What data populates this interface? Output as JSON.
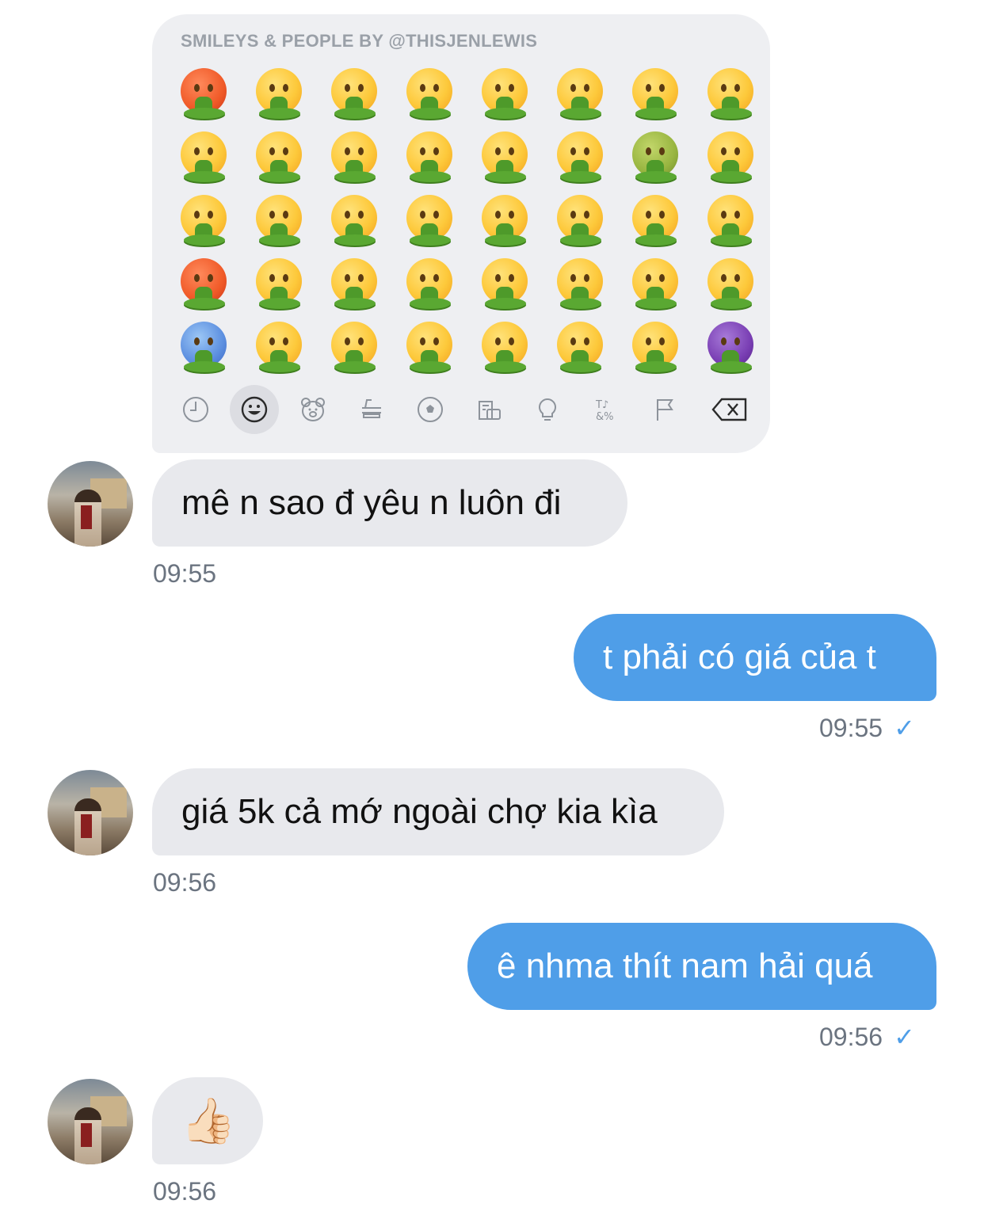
{
  "keyboard": {
    "title": "SMILEYS & PEOPLE BY @THISJENLEWIS",
    "emoji_rows": [
      [
        "angry-face-with-symbols-vomiting",
        "screaming-face-vomiting",
        "face-with-open-hands-vomiting",
        "neutral-face-vomiting",
        "hushed-face-vomiting",
        "sleeping-face-vomiting",
        "woozy-face-vomiting",
        "thermometer-face-vomiting"
      ],
      [
        "exploding-head-vomiting",
        "anxious-face-vomiting",
        "thinking-face-vomiting",
        "grimacing-face-vomiting",
        "frowning-face-vomiting",
        "lying-face-vomiting",
        "nauseated-face-vomiting",
        "bandaged-face-vomiting"
      ],
      [
        "flushed-face-vomiting",
        "fearful-face-vomiting",
        "hand-over-mouth-face-vomiting",
        "expressionless-face-vomiting",
        "worried-face-vomiting",
        "sleepy-face-vomiting",
        "tired-face-vomiting",
        "money-mouth-face-vomiting"
      ],
      [
        "hot-face-vomiting",
        "disappointed-face-vomiting",
        "shushing-face-vomiting",
        "grinning-teeth-face-vomiting",
        "astonished-face-vomiting",
        "dizzy-face-vomiting",
        "sneezing-face-vomiting",
        "cowboy-face-vomiting"
      ],
      [
        "cold-face-vomiting",
        "downcast-sweat-face-vomiting",
        "pinocchio-face-vomiting",
        "rolling-eyes-face-vomiting",
        "surprised-face-vomiting",
        "zipper-mouth-face-vomiting",
        "medical-mask-face-vomiting",
        "devil-face-vomiting"
      ]
    ],
    "emoji_face_colors": [
      [
        "red",
        "yellow",
        "yellow",
        "yellow",
        "yellow",
        "yellow",
        "yellow",
        "yellow"
      ],
      [
        "yellow",
        "yellow",
        "yellow",
        "yellow",
        "yellow",
        "yellow",
        "green",
        "yellow"
      ],
      [
        "yellow",
        "yellow",
        "yellow",
        "yellow",
        "yellow",
        "yellow",
        "yellow",
        "yellow"
      ],
      [
        "red",
        "yellow",
        "yellow",
        "yellow",
        "yellow",
        "yellow",
        "yellow",
        "yellow"
      ],
      [
        "blue",
        "yellow",
        "yellow",
        "yellow",
        "yellow",
        "yellow",
        "yellow",
        "purple"
      ]
    ],
    "categories": [
      "recent-clock-icon",
      "smiley-icon",
      "animal-bear-icon",
      "food-drink-icon",
      "sports-ball-icon",
      "travel-building-icon",
      "objects-bulb-icon",
      "symbols-icon",
      "flags-icon",
      "backspace-icon"
    ],
    "active_category": "smiley-icon"
  },
  "messages": [
    {
      "direction": "in",
      "text": "mê n sao đ yêu n luôn đi",
      "time": "09:55"
    },
    {
      "direction": "out",
      "text": "t phải có giá của t",
      "time": "09:55",
      "check": "✓"
    },
    {
      "direction": "in",
      "text": "giá 5k cả mớ ngoài chợ kia kìa",
      "time": "09:56"
    },
    {
      "direction": "out",
      "text": "ê nhma thít nam hải quá",
      "time": "09:56",
      "check": "✓"
    },
    {
      "direction": "in",
      "text": "👍🏻",
      "time": "09:56"
    }
  ],
  "colors": {
    "outgoing_bubble": "#4f9ee8",
    "incoming_bubble": "#e8e9ed",
    "timestamp": "#6b7480",
    "keyboard_bg": "#eeeff2"
  }
}
